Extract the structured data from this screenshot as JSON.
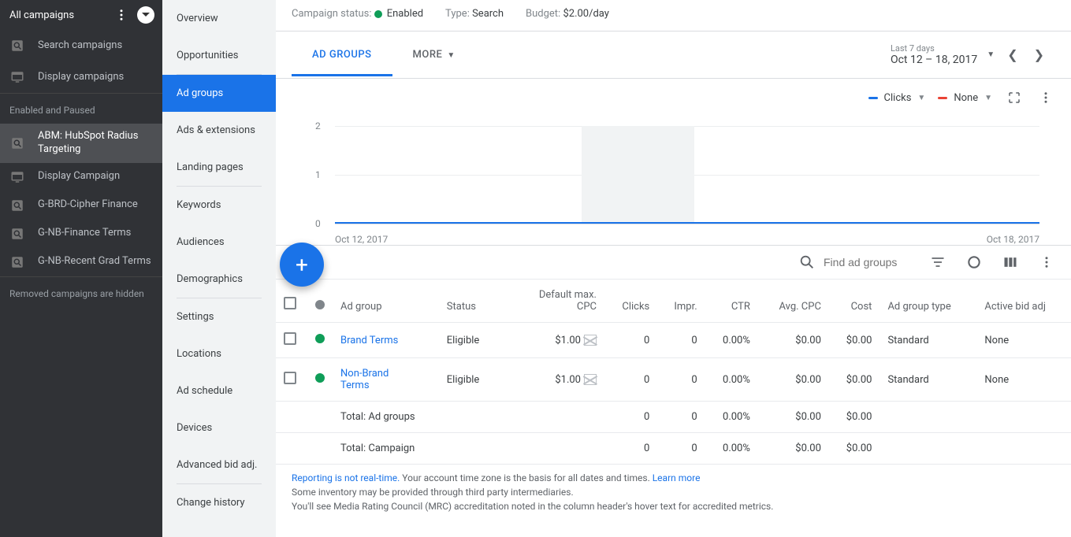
{
  "sidebar_dark": {
    "title": "All campaigns",
    "items_top": [
      {
        "icon": "search",
        "label": "Search campaigns"
      },
      {
        "icon": "display",
        "label": "Display campaigns"
      }
    ],
    "section_label": "Enabled and Paused",
    "items_campaigns": [
      {
        "icon": "search",
        "label": "ABM: HubSpot Radius Targeting",
        "active": true
      },
      {
        "icon": "display",
        "label": "Display Campaign"
      },
      {
        "icon": "search",
        "label": "G-BRD-Cipher Finance"
      },
      {
        "icon": "search",
        "label": "G-NB-Finance Terms"
      },
      {
        "icon": "search",
        "label": "G-NB-Recent Grad Terms"
      }
    ],
    "footer": "Removed campaigns are hidden"
  },
  "sidebar_light": {
    "items": [
      "Overview",
      "Opportunities",
      "Ad groups",
      "Ads & extensions",
      "Landing pages",
      "Keywords",
      "Audiences",
      "Demographics",
      "Settings",
      "Locations",
      "Ad schedule",
      "Devices",
      "Advanced bid adj.",
      "Change history"
    ],
    "active_index": 2,
    "dividers_after": [
      1,
      4,
      7,
      12
    ]
  },
  "status_bar": {
    "status_label": "Campaign status:",
    "status_value": "Enabled",
    "type_label": "Type:",
    "type_value": "Search",
    "budget_label": "Budget:",
    "budget_value": "$2.00/day"
  },
  "tabs": {
    "items": [
      "AD GROUPS",
      "MORE"
    ],
    "active": 0
  },
  "date_range": {
    "preset": "Last 7 days",
    "range": "Oct 12 – 18, 2017"
  },
  "chart_metrics": {
    "a": {
      "label": "Clicks",
      "color": "#1a73e8"
    },
    "b": {
      "label": "None",
      "color": "#ea4335"
    }
  },
  "chart_data": {
    "type": "line",
    "title": "",
    "xlabel": "",
    "ylabel": "",
    "ylim": [
      0,
      2
    ],
    "y_ticks": [
      0,
      1,
      2
    ],
    "x_ticks": [
      "Oct 12, 2017",
      "Oct 18, 2017"
    ],
    "highlight_band": [
      0.35,
      0.51
    ],
    "series": [
      {
        "name": "Clicks",
        "color": "#1a73e8",
        "values": [
          0,
          0,
          0,
          0,
          0,
          0,
          0
        ]
      }
    ]
  },
  "table": {
    "search_placeholder": "Find ad groups",
    "columns": [
      "Ad group",
      "Status",
      "Default max. CPC",
      "Clicks",
      "Impr.",
      "CTR",
      "Avg. CPC",
      "Cost",
      "Ad group type",
      "Active bid adj"
    ],
    "rows": [
      {
        "status": "green",
        "name": "Brand Terms",
        "status_text": "Eligible",
        "cpc": "$1.00",
        "clicks": "0",
        "impr": "0",
        "ctr": "0.00%",
        "avgcpc": "$0.00",
        "cost": "$0.00",
        "type": "Standard",
        "bidadj": "None"
      },
      {
        "status": "green",
        "name": "Non-Brand Terms",
        "status_text": "Eligible",
        "cpc": "$1.00",
        "clicks": "0",
        "impr": "0",
        "ctr": "0.00%",
        "avgcpc": "$0.00",
        "cost": "$0.00",
        "type": "Standard",
        "bidadj": "None"
      }
    ],
    "totals": [
      {
        "label": "Total: Ad groups",
        "clicks": "0",
        "impr": "0",
        "ctr": "0.00%",
        "avgcpc": "$0.00",
        "cost": "$0.00"
      },
      {
        "label": "Total: Campaign",
        "clicks": "0",
        "impr": "0",
        "ctr": "0.00%",
        "avgcpc": "$0.00",
        "cost": "$0.00"
      }
    ]
  },
  "footnote": {
    "link1": "Reporting is not real-time.",
    "text1": " Your account time zone is the basis for all dates and times. ",
    "link2": "Learn more",
    "line2": "Some inventory may be provided through third party intermediaries.",
    "line3": "You'll see Media Rating Council (MRC) accreditation noted in the column header's hover text for accredited metrics."
  }
}
